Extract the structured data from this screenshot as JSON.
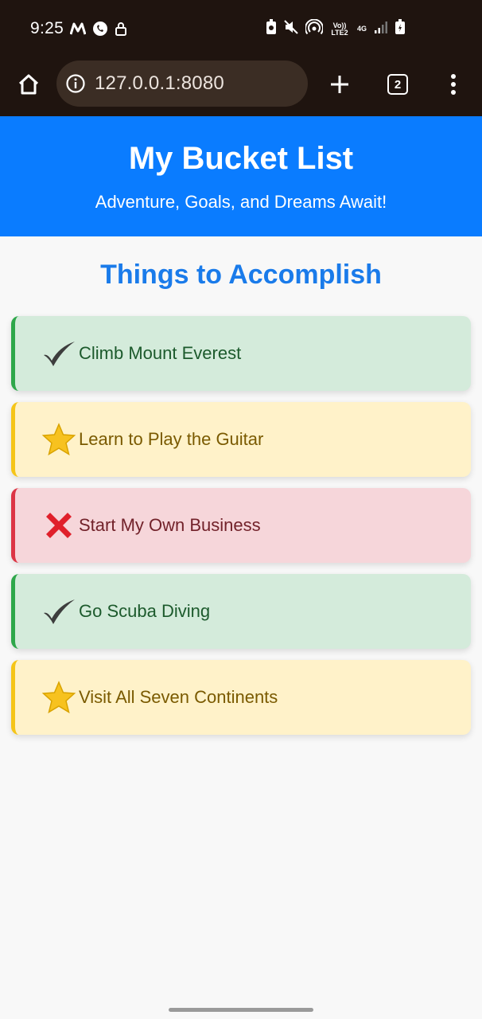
{
  "status_bar": {
    "time": "9:25",
    "volte_label": "Vo)) LTE2",
    "network_label": "4G"
  },
  "browser": {
    "url": "127.0.0.1:8080",
    "tab_count": "2"
  },
  "header": {
    "title": "My Bucket List",
    "subtitle": "Adventure, Goals, and Dreams Await!"
  },
  "main": {
    "section_title": "Things to Accomplish",
    "items": [
      {
        "label": "Climb Mount Everest",
        "status": "done",
        "icon": "check-icon"
      },
      {
        "label": "Learn to Play the Guitar",
        "status": "todo",
        "icon": "star-icon"
      },
      {
        "label": "Start My Own Business",
        "status": "fail",
        "icon": "cross-icon"
      },
      {
        "label": "Go Scuba Diving",
        "status": "done",
        "icon": "check-icon"
      },
      {
        "label": "Visit All Seven Continents",
        "status": "todo",
        "icon": "star-icon"
      }
    ]
  },
  "colors": {
    "header_bg": "#0a7cff",
    "section_title": "#1a7bea",
    "done_bg": "#d4ebdb",
    "done_border": "#2ea74a",
    "todo_bg": "#fff2c9",
    "todo_border": "#f5c518",
    "fail_bg": "#f6d6da",
    "fail_border": "#dc3545"
  }
}
